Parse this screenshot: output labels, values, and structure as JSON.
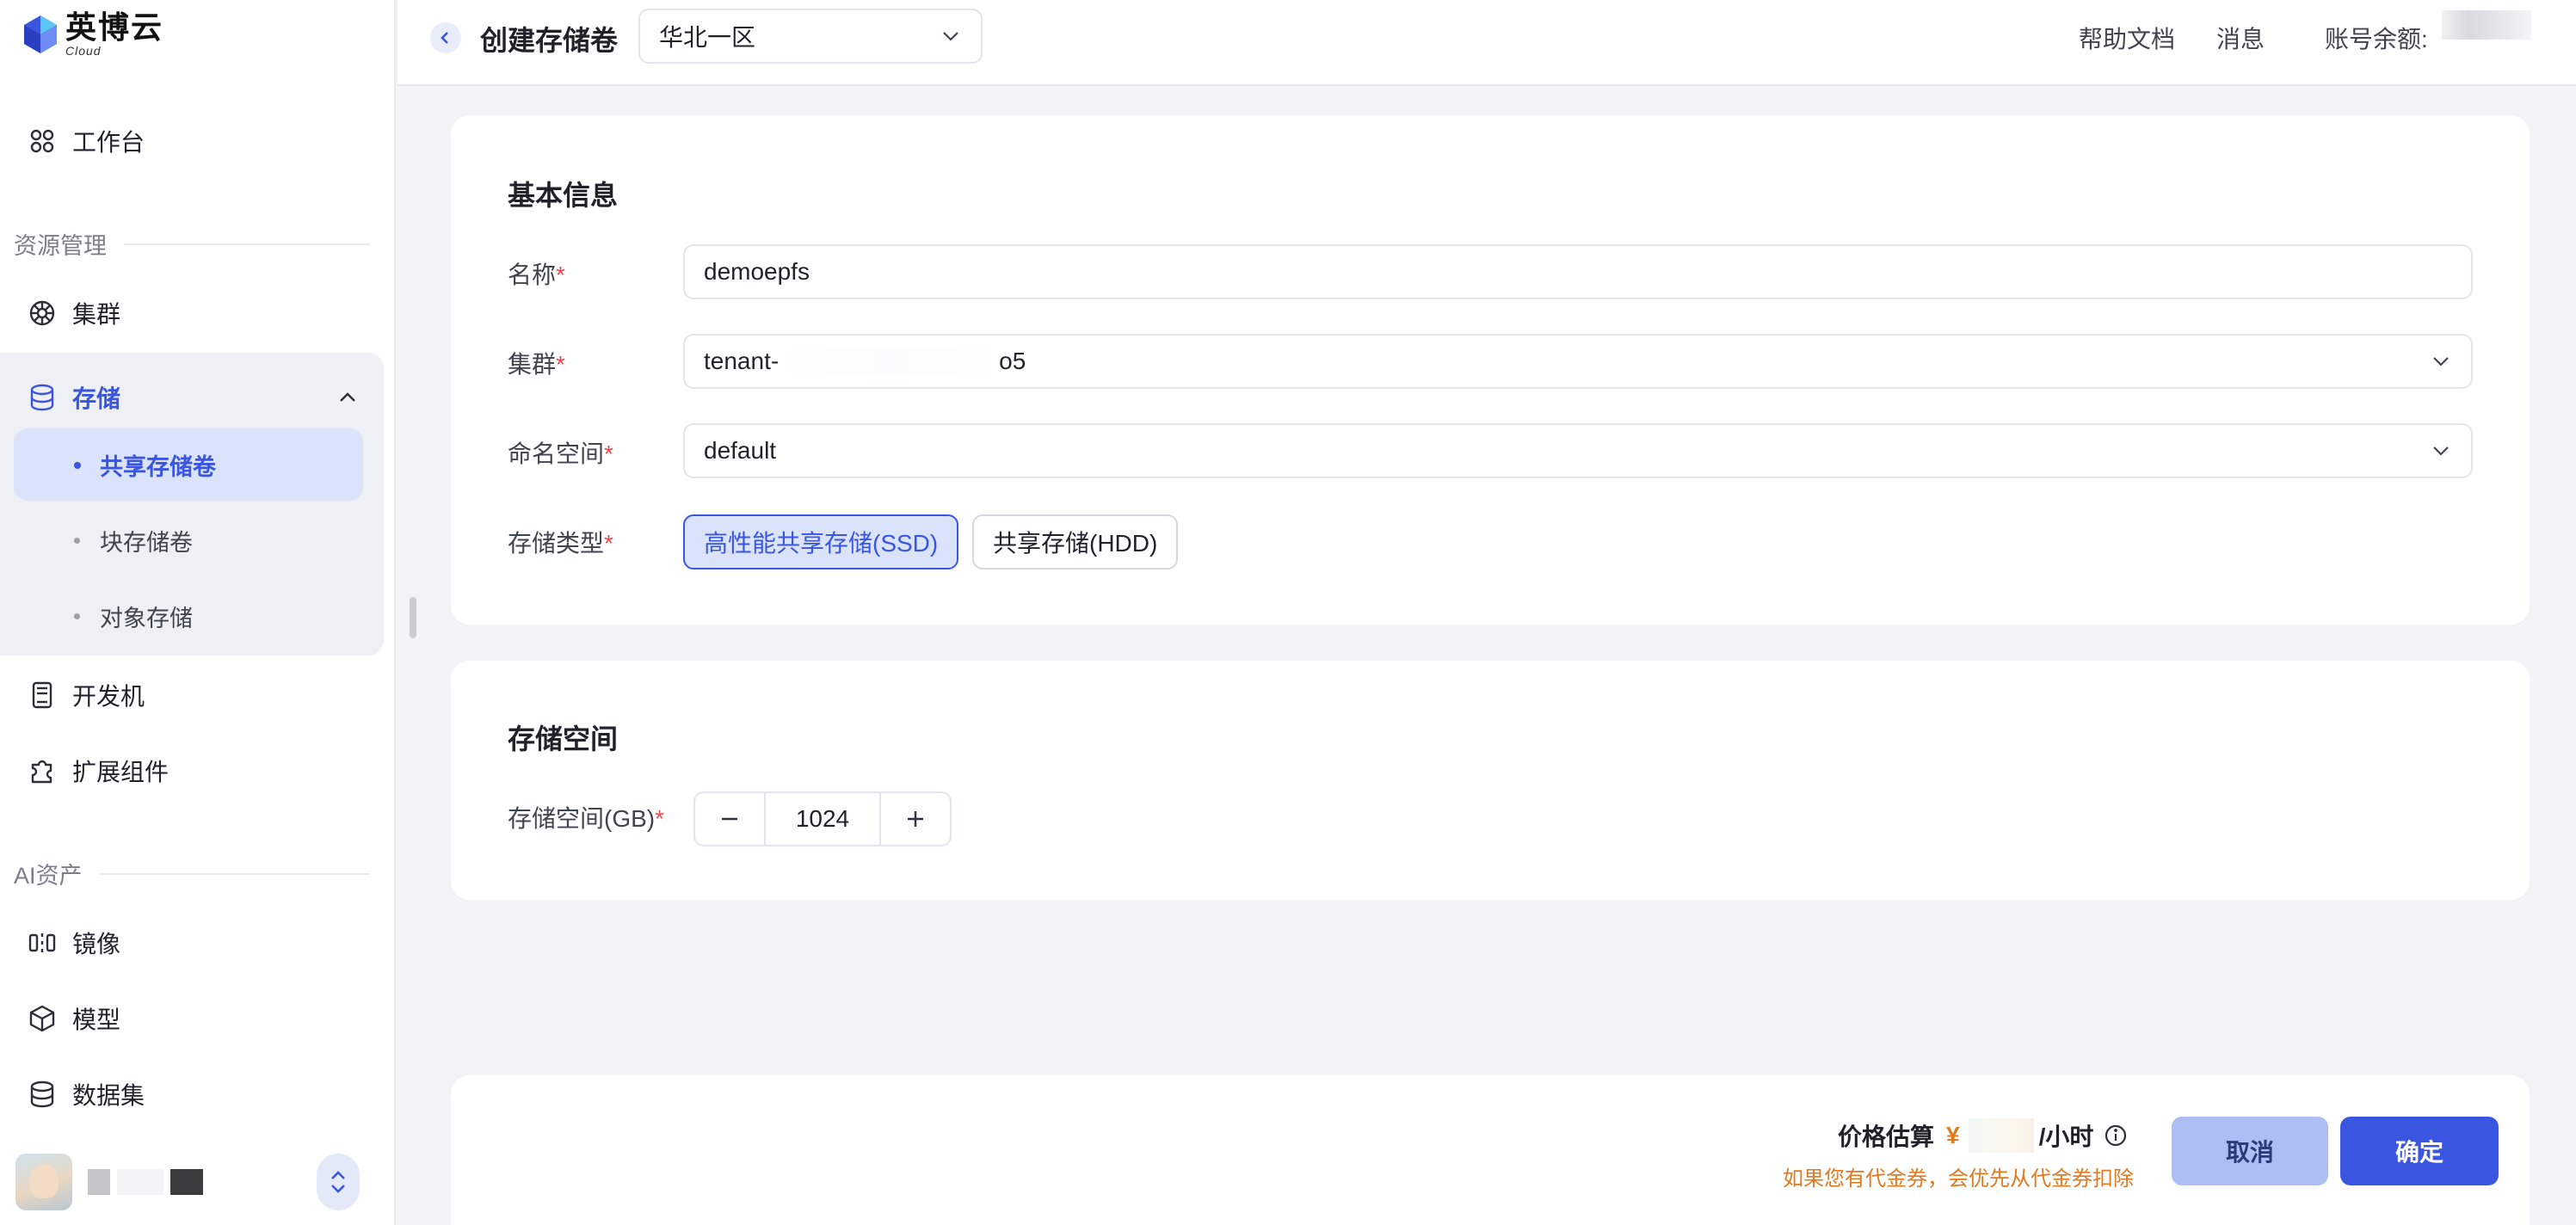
{
  "brand": {
    "name_cn": "英博云",
    "name_en": "Cloud"
  },
  "sidebar": {
    "workbench": "工作台",
    "section_resource": "资源管理",
    "cluster": "集群",
    "storage": {
      "label": "存储",
      "children": [
        {
          "label": "共享存储卷",
          "active": true
        },
        {
          "label": "块存储卷",
          "active": false
        },
        {
          "label": "对象存储",
          "active": false
        }
      ]
    },
    "devbox": "开发机",
    "extensions": "扩展组件",
    "section_ai": "AI资产",
    "image": "镜像",
    "model": "模型",
    "dataset": "数据集"
  },
  "header": {
    "title": "创建存储卷",
    "region": "华北一区",
    "help": "帮助文档",
    "messages": "消息",
    "balance_label": "账号余额:"
  },
  "basic_info": {
    "title": "基本信息",
    "name_label": "名称",
    "name_value": "demoepfs",
    "cluster_label": "集群",
    "cluster_prefix": "tenant-",
    "cluster_suffix": "o5",
    "namespace_label": "命名空间",
    "namespace_value": "default",
    "type_label": "存储类型",
    "type_options": [
      "高性能共享存储(SSD)",
      "共享存储(HDD)"
    ],
    "type_selected": "高性能共享存储(SSD)",
    "required_mark": "*"
  },
  "storage_space": {
    "title": "存储空间",
    "size_label": "存储空间(GB)",
    "size_value": "1024"
  },
  "footer": {
    "price_label": "价格估算",
    "currency": "¥",
    "unit": "/小时",
    "coupon_note": "如果您有代金券，会优先从代金券扣除",
    "cancel": "取消",
    "confirm": "确定"
  },
  "colors": {
    "accent": "#3a56e0",
    "accent_light": "#dbe3fb",
    "price": "#e07a1f",
    "required": "#e5484d"
  }
}
